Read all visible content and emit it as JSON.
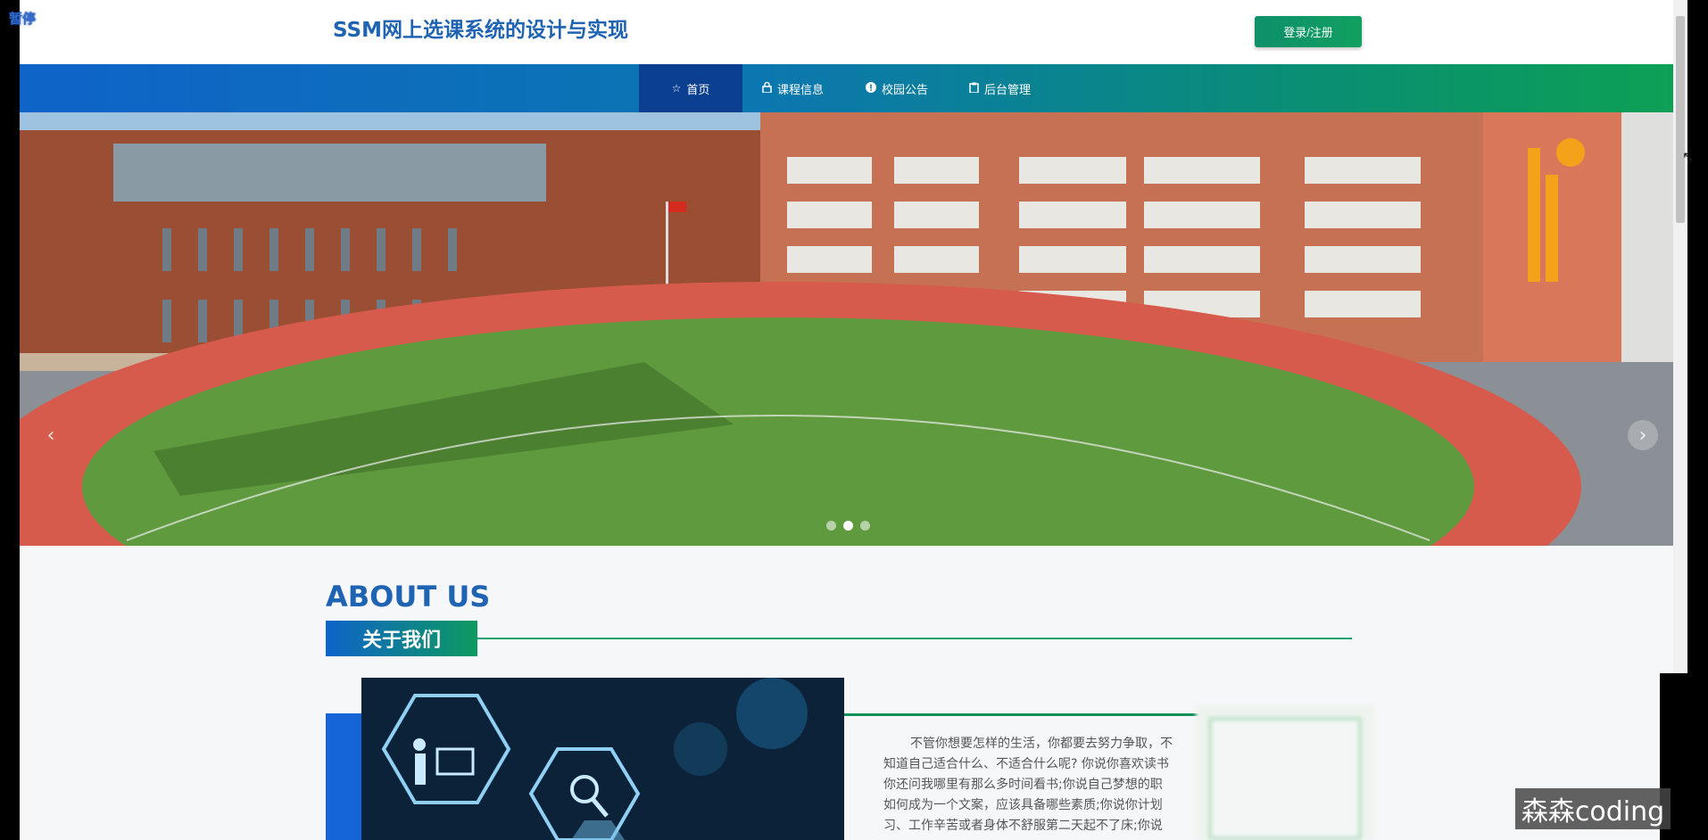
{
  "overlay": {
    "pause_label": "暂停",
    "watermark": "森森coding"
  },
  "header": {
    "title": "SSM网上选课系统的设计与实现",
    "login_label": "登录/注册"
  },
  "nav": {
    "items": [
      {
        "label": "首页",
        "icon": "star-icon",
        "active": true
      },
      {
        "label": "课程信息",
        "icon": "lock-icon",
        "active": false
      },
      {
        "label": "校园公告",
        "icon": "info-icon",
        "active": false
      },
      {
        "label": "后台管理",
        "icon": "clipboard-icon",
        "active": false
      }
    ]
  },
  "banner": {
    "prev_arrow": "‹",
    "next_arrow": "›",
    "slides": 3,
    "current_slide": 2
  },
  "about": {
    "title_en": "ABOUT US",
    "title_cn": "关于我们",
    "paragraph_lines": [
      "不管你想要怎样的生活，你都要去努力争取，不",
      "知道自己适合什么、不适合什么呢? 你说你喜欢读书",
      "你还问我哪里有那么多时间看书;你说自己梦想的职",
      "如何成为一个文案，应该具备哪些素质;你说你计划",
      "习、工作辛苦或者身体不舒服第二天起不了床;你说"
    ]
  },
  "colors": {
    "brand_blue": "#1f63b3",
    "nav_gradient_start": "#0f63c9",
    "nav_gradient_end": "#0da055",
    "active_nav": "#0b3f8f"
  }
}
